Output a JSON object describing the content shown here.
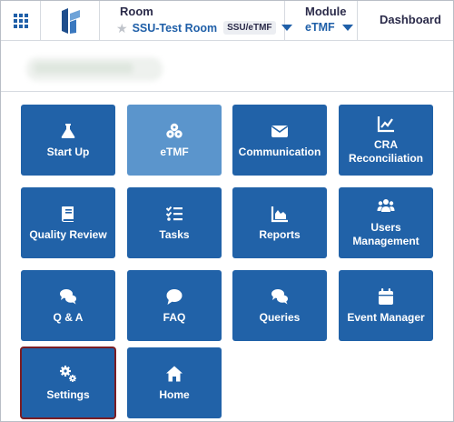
{
  "header": {
    "room_label": "Room",
    "room_name": "SSU-Test Room",
    "room_badge": "SSU/eTMF",
    "module_label": "Module",
    "module_value": "eTMF",
    "dashboard_label": "Dashboard"
  },
  "tiles": [
    {
      "label": "Start Up",
      "icon": "flask-icon"
    },
    {
      "label": "eTMF",
      "icon": "cubes-icon",
      "active": true
    },
    {
      "label": "Communication",
      "icon": "envelope-icon"
    },
    {
      "label": "CRA Reconciliation",
      "icon": "line-chart-icon"
    },
    {
      "label": "Quality Review",
      "icon": "book-icon"
    },
    {
      "label": "Tasks",
      "icon": "checklist-icon"
    },
    {
      "label": "Reports",
      "icon": "area-chart-icon"
    },
    {
      "label": "Users Management",
      "icon": "users-icon"
    },
    {
      "label": "Q & A",
      "icon": "chat-bubbles-icon"
    },
    {
      "label": "FAQ",
      "icon": "chat-bubble-icon"
    },
    {
      "label": "Queries",
      "icon": "chat-bubbles-icon"
    },
    {
      "label": "Event Manager",
      "icon": "calendar-icon"
    },
    {
      "label": "Settings",
      "icon": "gears-icon",
      "selected": true
    },
    {
      "label": "Home",
      "icon": "home-icon"
    }
  ],
  "colors": {
    "tile": "#2162a8",
    "tile_active": "#5b95cc",
    "selected_outline": "#7a1d24",
    "link_blue": "#1f5fa8"
  }
}
